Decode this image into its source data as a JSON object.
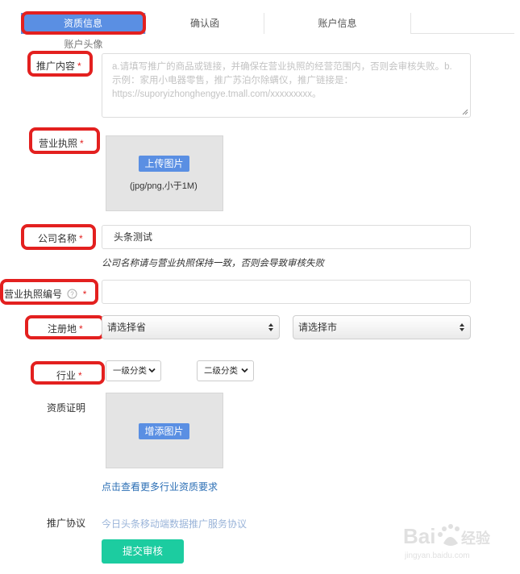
{
  "tabs": [
    {
      "label": "资质信息",
      "active": true
    },
    {
      "label": "确认函",
      "active": false
    },
    {
      "label": "账户信息",
      "active": false
    }
  ],
  "tab_row2": {
    "label": "账户头像"
  },
  "fields": {
    "promo_content": {
      "label": "推广内容",
      "required": "*",
      "placeholder": "a.请填写推广的商品或链接，并确保在营业执照的经营范围内，否则会审核失败。b.示例：家用小电器零售，推广苏泊尔除螨仪，推广链接是：https://suporyizhonghengye.tmall.com/xxxxxxxxx。"
    },
    "business_license": {
      "label": "营业执照",
      "required": "*",
      "upload_label": "上传图片",
      "upload_hint": "(jpg/png,小于1M)"
    },
    "company_name": {
      "label": "公司名称",
      "required": "*",
      "value": "头条测试",
      "hint": "公司名称请与营业执照保持一致，否则会导致审核失败"
    },
    "license_number": {
      "label": "营业执照编号",
      "required": "*",
      "help_icon": "question-circle-icon"
    },
    "registration": {
      "label": "注册地",
      "required": "*",
      "province_select": "请选择省",
      "city_select": "请选择市"
    },
    "industry": {
      "label": "行业",
      "required": "*",
      "primary_select": "一级分类",
      "secondary_select": "二级分类"
    },
    "qualification": {
      "label": "资质证明",
      "upload_label": "增添图片",
      "more_link": "点击查看更多行业资质要求"
    },
    "agreement": {
      "label": "推广协议",
      "link": "今日头条移动端数据推广服务协议"
    }
  },
  "submit_label": "提交审核",
  "watermark": {
    "brand": "Baidu经验",
    "url": "jingyan.baidu.com"
  },
  "colors": {
    "tab_active": "#5a8fe3",
    "highlight": "#e3201f",
    "submit": "#1ccca0",
    "link": "#2c6fb5"
  }
}
